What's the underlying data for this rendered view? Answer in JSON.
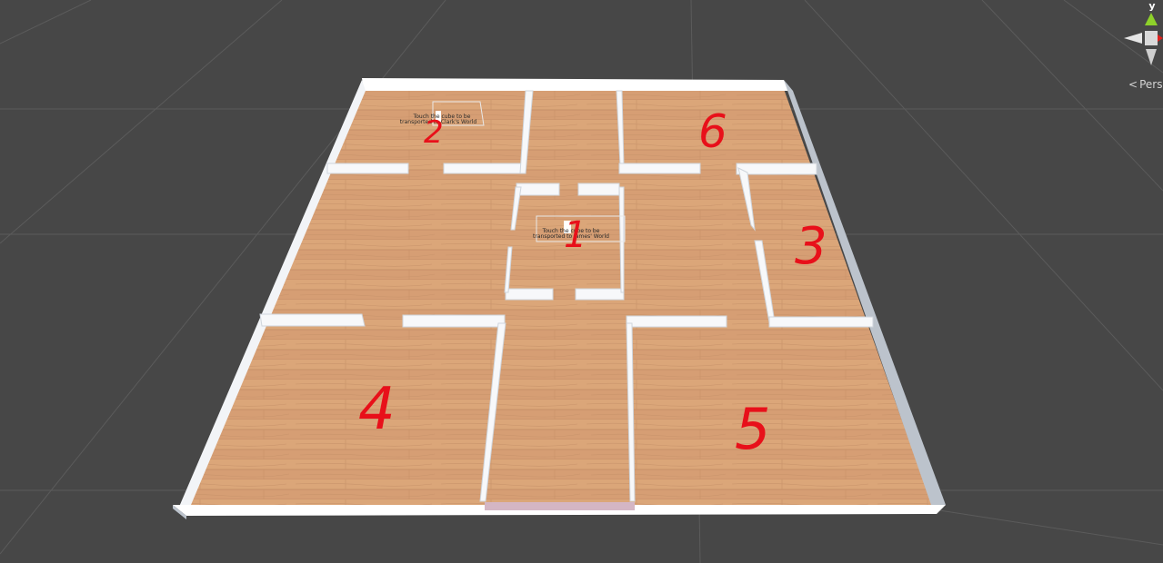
{
  "scene_view": {
    "projection_label": "Pers",
    "gizmo_axis_label": "y",
    "colors": {
      "background": "#474747",
      "grid": "#5d5d5d",
      "floor_light": "#d9a27a",
      "floor_dark": "#c78a5d",
      "wall_top": "#ffffff",
      "wall_side": "#bcc3cc",
      "annotation": "#e8101a",
      "gizmo_y": "#8ed12a",
      "gizmo_x": "#e0211d"
    }
  },
  "room_numbers": [
    "1",
    "2",
    "3",
    "4",
    "5",
    "6"
  ],
  "signs": [
    {
      "line1": "Touch the cube to be",
      "line2": "transported to Clark's World"
    },
    {
      "line1": "Touch the cube to be",
      "line2": "transported to James' World"
    }
  ]
}
